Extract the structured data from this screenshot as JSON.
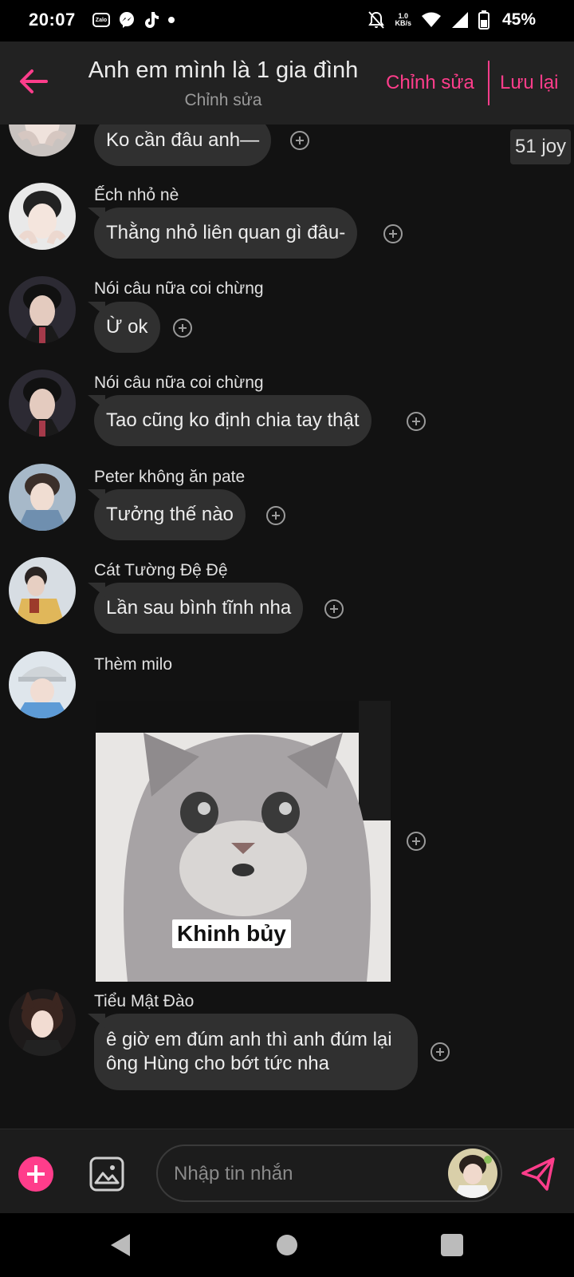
{
  "status_bar": {
    "time": "20:07",
    "zalo_label": "Zalo",
    "net_speed_value": "1.0",
    "net_speed_unit": "KB/s",
    "battery": "45%",
    "icons": [
      "zalo-icon",
      "messenger-icon",
      "tiktok-icon",
      "dot-icon",
      "bell-off-icon",
      "wifi-icon",
      "signal-icon",
      "battery-icon"
    ]
  },
  "header": {
    "title": "Anh em mình là 1 gia đình",
    "subtitle": "Chỉnh sửa",
    "edit_label": "Chỉnh sửa",
    "save_label": "Lưu lại"
  },
  "messages": [
    {
      "sender": "",
      "text": "Ko cần đâu anh—",
      "reaction": "51 joy"
    },
    {
      "sender": "Ếch nhỏ nè",
      "text": "Thằng nhỏ liên quan gì đâu-"
    },
    {
      "sender": "Nói câu nữa coi chừng",
      "text": "Ừ ok"
    },
    {
      "sender": "Nói câu nữa coi chừng",
      "text": "Tao cũng ko định chia tay thật"
    },
    {
      "sender": "Peter không ăn pate",
      "text": "Tưởng thế nào"
    },
    {
      "sender": "Cát Tường Đệ Đệ",
      "text": "Lần sau bình tĩnh nha"
    },
    {
      "sender": "Thèm milo",
      "image_caption": "Khinh bủy"
    },
    {
      "sender": "Tiểu Mật Đào",
      "text": "ê giờ em đúm anh thì anh đúm lại ông Hùng cho bớt tức nha"
    }
  ],
  "input": {
    "placeholder": "Nhập tin nhắn"
  },
  "colors": {
    "accent": "#ff3d8b",
    "background": "#121212",
    "bubble": "#303030"
  }
}
